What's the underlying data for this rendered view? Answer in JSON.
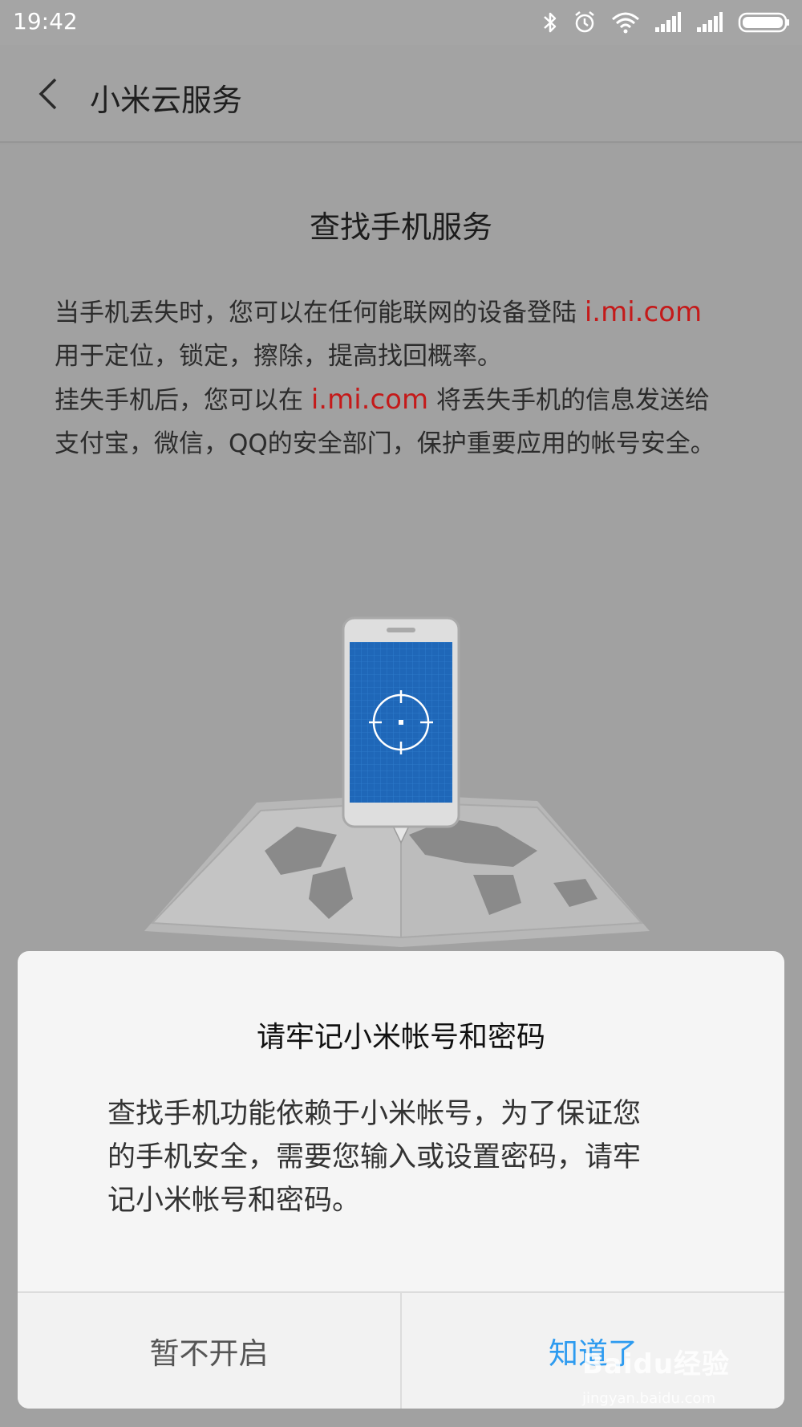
{
  "status_bar": {
    "time": "19:42",
    "icons": [
      "bluetooth-icon",
      "alarm-icon",
      "wifi-icon",
      "signal-icon",
      "signal-icon",
      "battery-icon"
    ]
  },
  "header": {
    "back_icon": "chevron-left-icon",
    "title": "小米云服务"
  },
  "content": {
    "heading": "查找手机服务",
    "line1_text": "当手机丢失时，您可以在任何能联网的设备登陆 ",
    "line1_link": "i.mi.com",
    "line2": "用于定位，锁定，擦除，提高找回概率。",
    "line3_pre": "挂失手机后，您可以在 ",
    "line3_link": "i.mi.com",
    "line3_post": " 将丢失手机的信息发送给",
    "line4": "支付宝，微信，QQ的安全部门，保护重要应用的帐号安全。",
    "illustration": "phone-locator-map-illustration",
    "link_color": "#c41a1a"
  },
  "dialog": {
    "title": "请牢记小米帐号和密码",
    "message_lines": [
      "查找手机功能依赖于小米帐号，为了保证您",
      "的手机安全，需要您输入或设置密码，请牢",
      "记小米帐号和密码。"
    ],
    "cancel_label": "暂不开启",
    "ok_label": "知道了",
    "ok_color": "#2d9bf0"
  },
  "watermark": {
    "brand": "Baidu经验",
    "url": "jingyan.baidu.com"
  }
}
